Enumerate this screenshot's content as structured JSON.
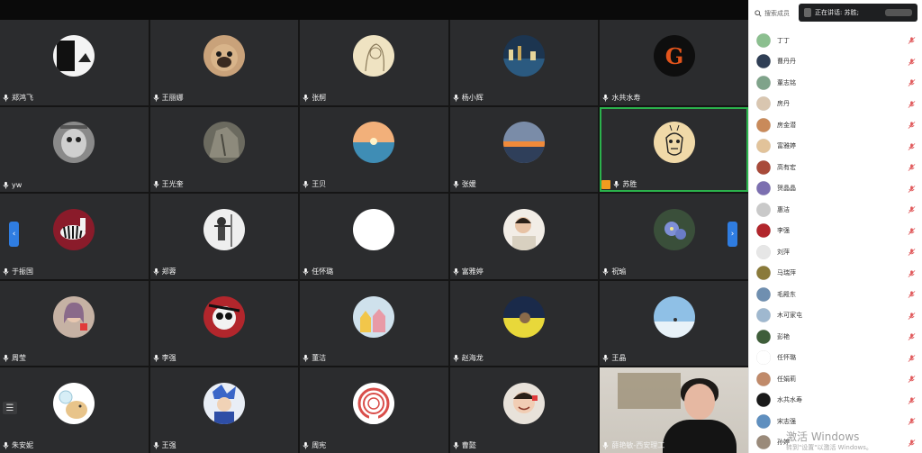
{
  "participants": [
    {
      "name": "郑鸿飞",
      "avatar": "dark-phone"
    },
    {
      "name": "王丽娜",
      "avatar": "pug-dog"
    },
    {
      "name": "张舸",
      "avatar": "sketch-girl"
    },
    {
      "name": "杨小辉",
      "avatar": "night-city"
    },
    {
      "name": "水共水寿",
      "avatar": "fire-g"
    },
    {
      "name": "yw",
      "avatar": "bw-animal"
    },
    {
      "name": "王光奎",
      "avatar": "rock"
    },
    {
      "name": "王贝",
      "avatar": "sea-sunset"
    },
    {
      "name": "张媛",
      "avatar": "sunset"
    },
    {
      "name": "苏胜",
      "avatar": "cartoon-face",
      "active": true,
      "host": true
    },
    {
      "name": "于振国",
      "avatar": "zebra"
    },
    {
      "name": "郑蓉",
      "avatar": "bw-person"
    },
    {
      "name": "任怀璐",
      "avatar": "white"
    },
    {
      "name": "富雅婷",
      "avatar": "child"
    },
    {
      "name": "祝瑜",
      "avatar": "flower"
    },
    {
      "name": "周莹",
      "avatar": "woman-pink"
    },
    {
      "name": "李强",
      "avatar": "red-cartoon"
    },
    {
      "name": "董洁",
      "avatar": "houses"
    },
    {
      "name": "赵海龙",
      "avatar": "kid-yellow"
    },
    {
      "name": "王晶",
      "avatar": "snow"
    },
    {
      "name": "朱安妮",
      "avatar": "cartoon-dog"
    },
    {
      "name": "王强",
      "avatar": "anime-blue"
    },
    {
      "name": "周宪",
      "avatar": "ring-logo"
    },
    {
      "name": "曹懿",
      "avatar": "smile-kid"
    },
    {
      "name": "薛艳敏-西安理工",
      "avatar": "video",
      "video": true
    }
  ],
  "panel": {
    "search_placeholder": "搜索成员",
    "speaking_label": "正在讲话: 苏胜;",
    "members": [
      {
        "name": "丁丁",
        "color": "#8bbf8f"
      },
      {
        "name": "曹丹丹",
        "color": "#2f3e55"
      },
      {
        "name": "董志铭",
        "color": "#7fa38a"
      },
      {
        "name": "房丹",
        "color": "#d9c6b0"
      },
      {
        "name": "房金潜",
        "color": "#c98a5a"
      },
      {
        "name": "富雅婷",
        "color": "#e2c39a"
      },
      {
        "name": "高有宏",
        "color": "#a84a3a"
      },
      {
        "name": "贺晶晶",
        "color": "#7c6fb0"
      },
      {
        "name": "惠洁",
        "color": "#c9c9c9"
      },
      {
        "name": "李强",
        "color": "#b2262c"
      },
      {
        "name": "刘萍",
        "color": "#e6e6e6"
      },
      {
        "name": "马瑞萍",
        "color": "#8a7a3a"
      },
      {
        "name": "毛殿东",
        "color": "#6f8fb0"
      },
      {
        "name": "木可家屯",
        "color": "#9fb8cf"
      },
      {
        "name": "彭艳",
        "color": "#3f5e3a"
      },
      {
        "name": "任怀璐",
        "color": "#ffffff"
      },
      {
        "name": "任娟莉",
        "color": "#c08a6a"
      },
      {
        "name": "水共水寿",
        "color": "#1a1a1a"
      },
      {
        "name": "宋志强",
        "color": "#5f8fbf"
      },
      {
        "name": "孙婷",
        "color": "#9a8a7a"
      }
    ]
  },
  "watermark": {
    "line1": "激活 Windows",
    "line2": "转到\"设置\"以激活 Windows。"
  },
  "colors": {
    "accent": "#2f7de1",
    "active_border": "#2bb24c",
    "host_badge": "#f29b1f",
    "muted_mic": "#e0585a"
  }
}
